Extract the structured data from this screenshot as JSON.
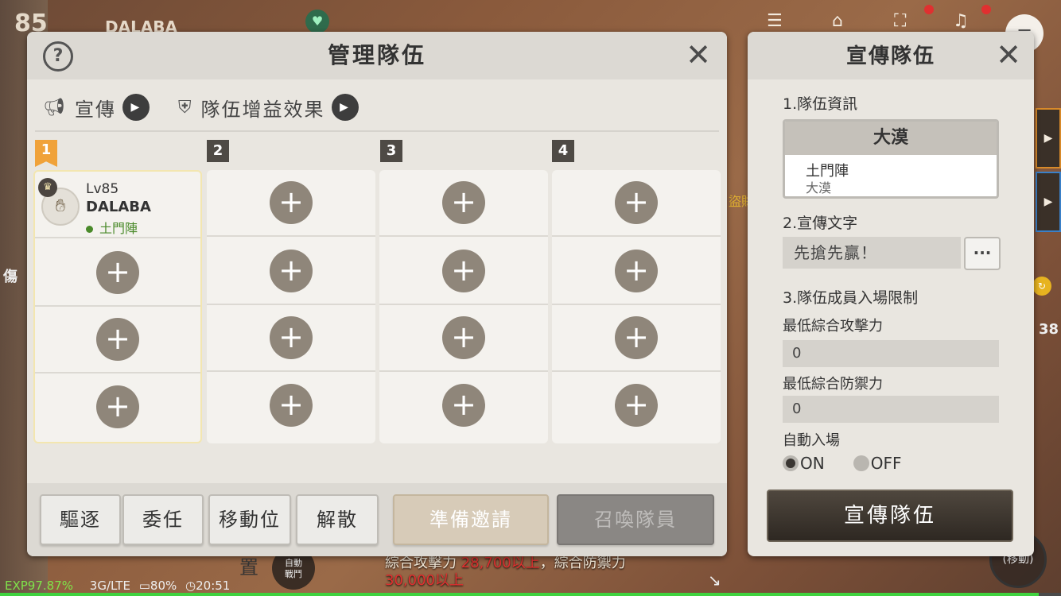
{
  "hud": {
    "level": "85",
    "player_name": "DALABA",
    "side_text": "傷",
    "gold_text": "盜賊",
    "count_38": "38",
    "move_label": "(移動)",
    "battle_label": "自動\n戰鬥",
    "notice_line1_a": "綜合攻擊力 ",
    "notice_line1_red": "28,700以上",
    "notice_line1_b": "，綜合防禦力",
    "notice_line2_red": "30,000以上",
    "exp": "EXP97.87%",
    "network": "3G/LTE",
    "battery": "80%",
    "time": "20:51",
    "exp_fraction": 0.9787
  },
  "manage_panel": {
    "title": "管理隊伍",
    "help_icon": "question-icon",
    "close_icon": "close-icon",
    "promo_label": "宣傳",
    "buff_label": "隊伍增益效果",
    "columns": [
      {
        "num": "1"
      },
      {
        "num": "2"
      },
      {
        "num": "3"
      },
      {
        "num": "4"
      }
    ],
    "leader": {
      "level": "Lv85",
      "name": "DALABA",
      "class": "土門陣"
    },
    "buttons": {
      "kick": "驅逐",
      "delegate": "委任",
      "move": "移動位置",
      "disband": "解散",
      "ready_invite": "準備邀請",
      "summon": "召喚隊員"
    }
  },
  "promo_panel": {
    "title": "宣傳隊伍",
    "section1": "1.隊伍資訊",
    "info_header": "大漠",
    "info_line1": "土門陣",
    "info_line2": "大漠",
    "section2": "2.宣傳文字",
    "promo_text": "先搶先贏！",
    "more_label": "···",
    "section3": "3.隊伍成員入場限制",
    "min_attack_label": "最低綜合攻擊力",
    "min_attack_value": "0",
    "min_defense_label": "最低綜合防禦力",
    "min_defense_value": "0",
    "auto_join_label": "自動入場",
    "on_label": "ON",
    "off_label": "OFF",
    "auto_join_selected": "ON",
    "submit_label": "宣傳隊伍"
  }
}
